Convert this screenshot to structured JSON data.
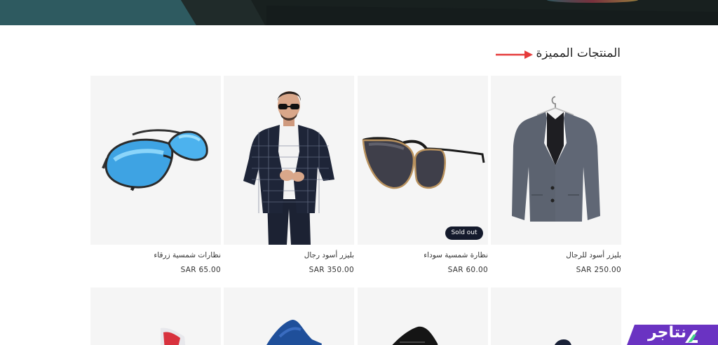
{
  "section": {
    "title": "المنتجات المميزة",
    "accent_color": "#e53b3b"
  },
  "products": [
    {
      "name": "نظارات شمسية زرقاء",
      "price": "SAR 65.00",
      "image": "blue-aviator-sunglasses",
      "badge": null
    },
    {
      "name": "بليزر أسود رجال",
      "price": "SAR 350.00",
      "image": "man-in-checked-blazer",
      "badge": null
    },
    {
      "name": "نظارة شمسية سوداء",
      "price": "SAR 60.00",
      "image": "black-cat-eye-sunglasses",
      "badge": "Sold out"
    },
    {
      "name": "بليزر أسود للرجال",
      "price": "SAR 250.00",
      "image": "grey-blazer-on-hanger",
      "badge": null
    }
  ],
  "second_row": [
    {
      "image": "red-white-sneaker"
    },
    {
      "image": "blue-sneaker"
    },
    {
      "image": "black-sneaker"
    },
    {
      "image": "navy-shoe"
    }
  ],
  "brand": {
    "name": "نتاجر",
    "color": "#6a33c2"
  }
}
